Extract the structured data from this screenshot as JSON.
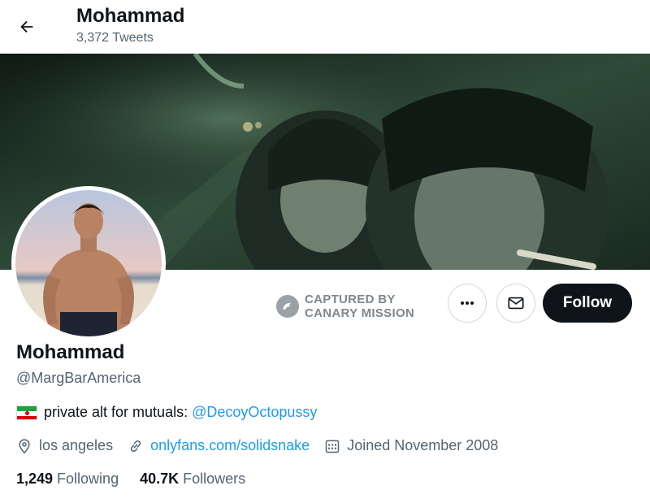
{
  "header": {
    "name": "Mohammad",
    "tweet_count": "3,372 Tweets"
  },
  "profile": {
    "display_name": "Mohammad",
    "handle": "@MargBarAmerica",
    "bio_text": "private alt for mutuals:",
    "bio_mention": "@DecoyOctopussy",
    "location": "los angeles",
    "website": "onlyfans.com/solidsnake",
    "joined": "Joined November 2008",
    "following_count": "1,249",
    "following_label": "Following",
    "followers_count": "40.7K",
    "followers_label": "Followers"
  },
  "actions": {
    "follow_label": "Follow"
  },
  "stamp": {
    "line1": "CAPTURED BY",
    "line2": "CANARY MISSION"
  },
  "colors": {
    "link": "#1d9bf0",
    "follow_bg": "#0f1419",
    "secondary_text": "#536471"
  }
}
